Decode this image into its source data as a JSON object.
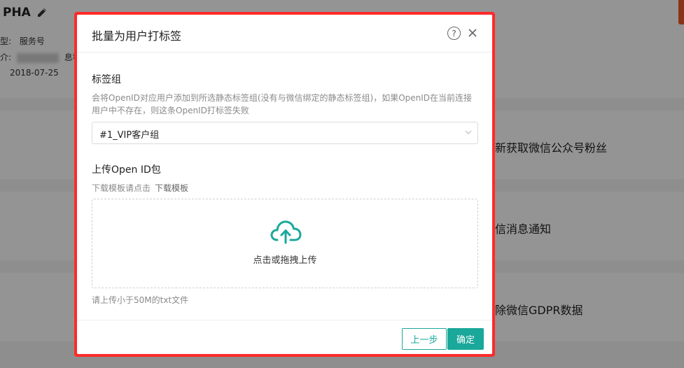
{
  "background": {
    "title": "PHA",
    "type_label": "型:",
    "type_value": "服务号",
    "desc_label": "介:",
    "desc_tail": "息科",
    "date": "2018-07-25",
    "cards": [
      {
        "text": "新获取微信公众号粉丝"
      },
      {
        "text": "信消息通知"
      },
      {
        "text": "除微信GDPR数据"
      }
    ]
  },
  "modal": {
    "title": "批量为用户打标签",
    "help_symbol": "?",
    "tag_group_label": "标签组",
    "tag_group_desc": "会将OpenID对应用户添加到所选静态标签组(没有与微信绑定的静态标签组)，如果OpenID在当前连接用户中不存在，则这条OpenID打标签失败",
    "tag_group_value": "#1_VIP客户组",
    "upload_label": "上传Open ID包",
    "template_prefix": "下载模板请点击",
    "template_link": "下载模板",
    "drop_text": "点击或拖拽上传",
    "upload_hint": "请上传小于50M的txt文件",
    "prev_button": "上一步",
    "ok_button": "确定"
  },
  "colors": {
    "accent": "#1aa89a",
    "highlight": "#ff2a2a"
  },
  "icons": [
    "pencil-icon",
    "help-icon",
    "close-icon",
    "chevron-down-icon",
    "cloud-upload-icon"
  ]
}
